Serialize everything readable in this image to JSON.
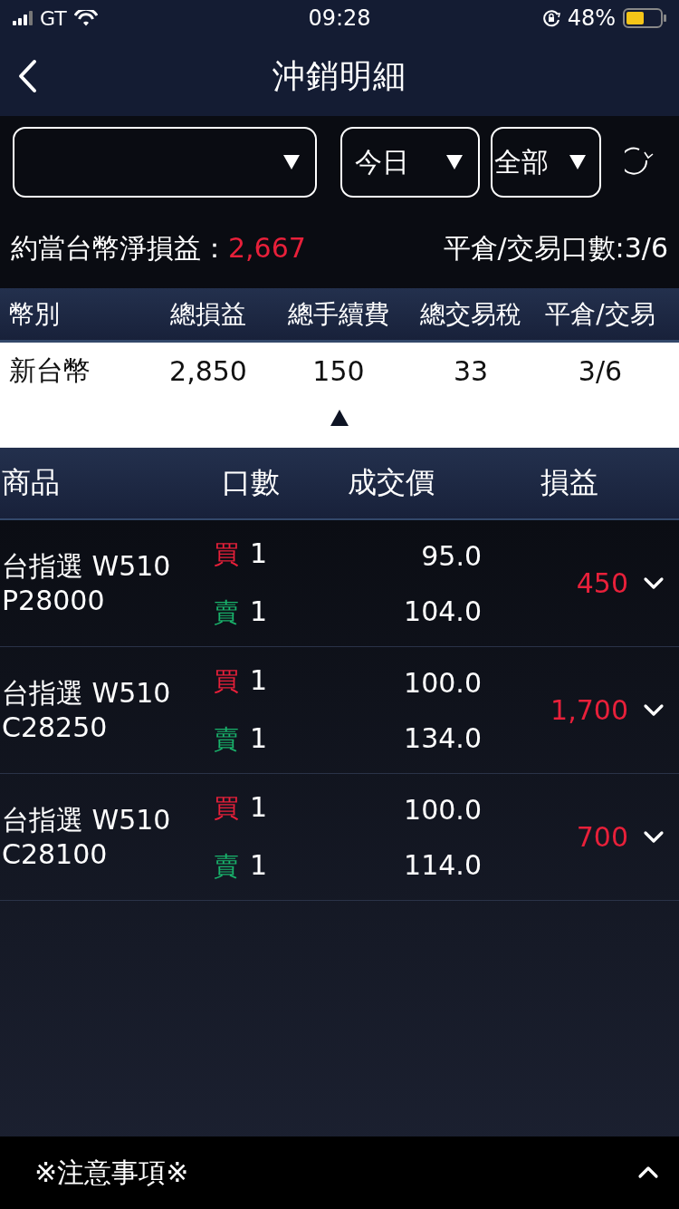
{
  "status_bar": {
    "carrier": "GT",
    "time": "09:28",
    "battery": "48%"
  },
  "header": {
    "title": "沖銷明細"
  },
  "filters": [
    {
      "kind": "account"
    },
    {
      "kind": "select",
      "label": "今日"
    },
    {
      "kind": "select",
      "label": "全部"
    }
  ],
  "summary": {
    "net_label": "約當台幣淨損益：",
    "net_value": "2,667",
    "count_text": "平倉/交易口數:3/6"
  },
  "currency_table": {
    "columns": [
      "幣別",
      "總損益",
      "總手續費",
      "總交易稅",
      "平倉/交易"
    ],
    "rows": [
      [
        "新台幣",
        "2,850",
        "150",
        "33",
        "3/6"
      ]
    ],
    "expanded": true
  },
  "trades": {
    "columns": [
      "商品",
      "口數",
      "成交價",
      "損益"
    ],
    "rows": [
      {
        "name_lines": [
          "台指選 W510",
          "P28000"
        ],
        "legs": [
          {
            "kind": "buy",
            "side": "買",
            "qty": "1",
            "price": "95.0"
          },
          {
            "kind": "sell",
            "side": "賣",
            "qty": "1",
            "price": "104.0"
          }
        ],
        "pnl": "450",
        "expanded": false
      },
      {
        "name_lines": [
          "台指選 W510",
          "C28250"
        ],
        "legs": [
          {
            "kind": "buy",
            "side": "買",
            "qty": "1",
            "price": "100.0"
          },
          {
            "kind": "sell",
            "side": "賣",
            "qty": "1",
            "price": "134.0"
          }
        ],
        "pnl": "1,700",
        "expanded": false
      },
      {
        "name_lines": [
          "台指選 W510",
          "C28100"
        ],
        "legs": [
          {
            "kind": "buy",
            "side": "買",
            "qty": "1",
            "price": "100.0"
          },
          {
            "kind": "sell",
            "side": "賣",
            "qty": "1",
            "price": "114.0"
          }
        ],
        "pnl": "700",
        "expanded": false
      }
    ]
  },
  "footer": {
    "label": "※注意事項※",
    "expanded": false
  }
}
